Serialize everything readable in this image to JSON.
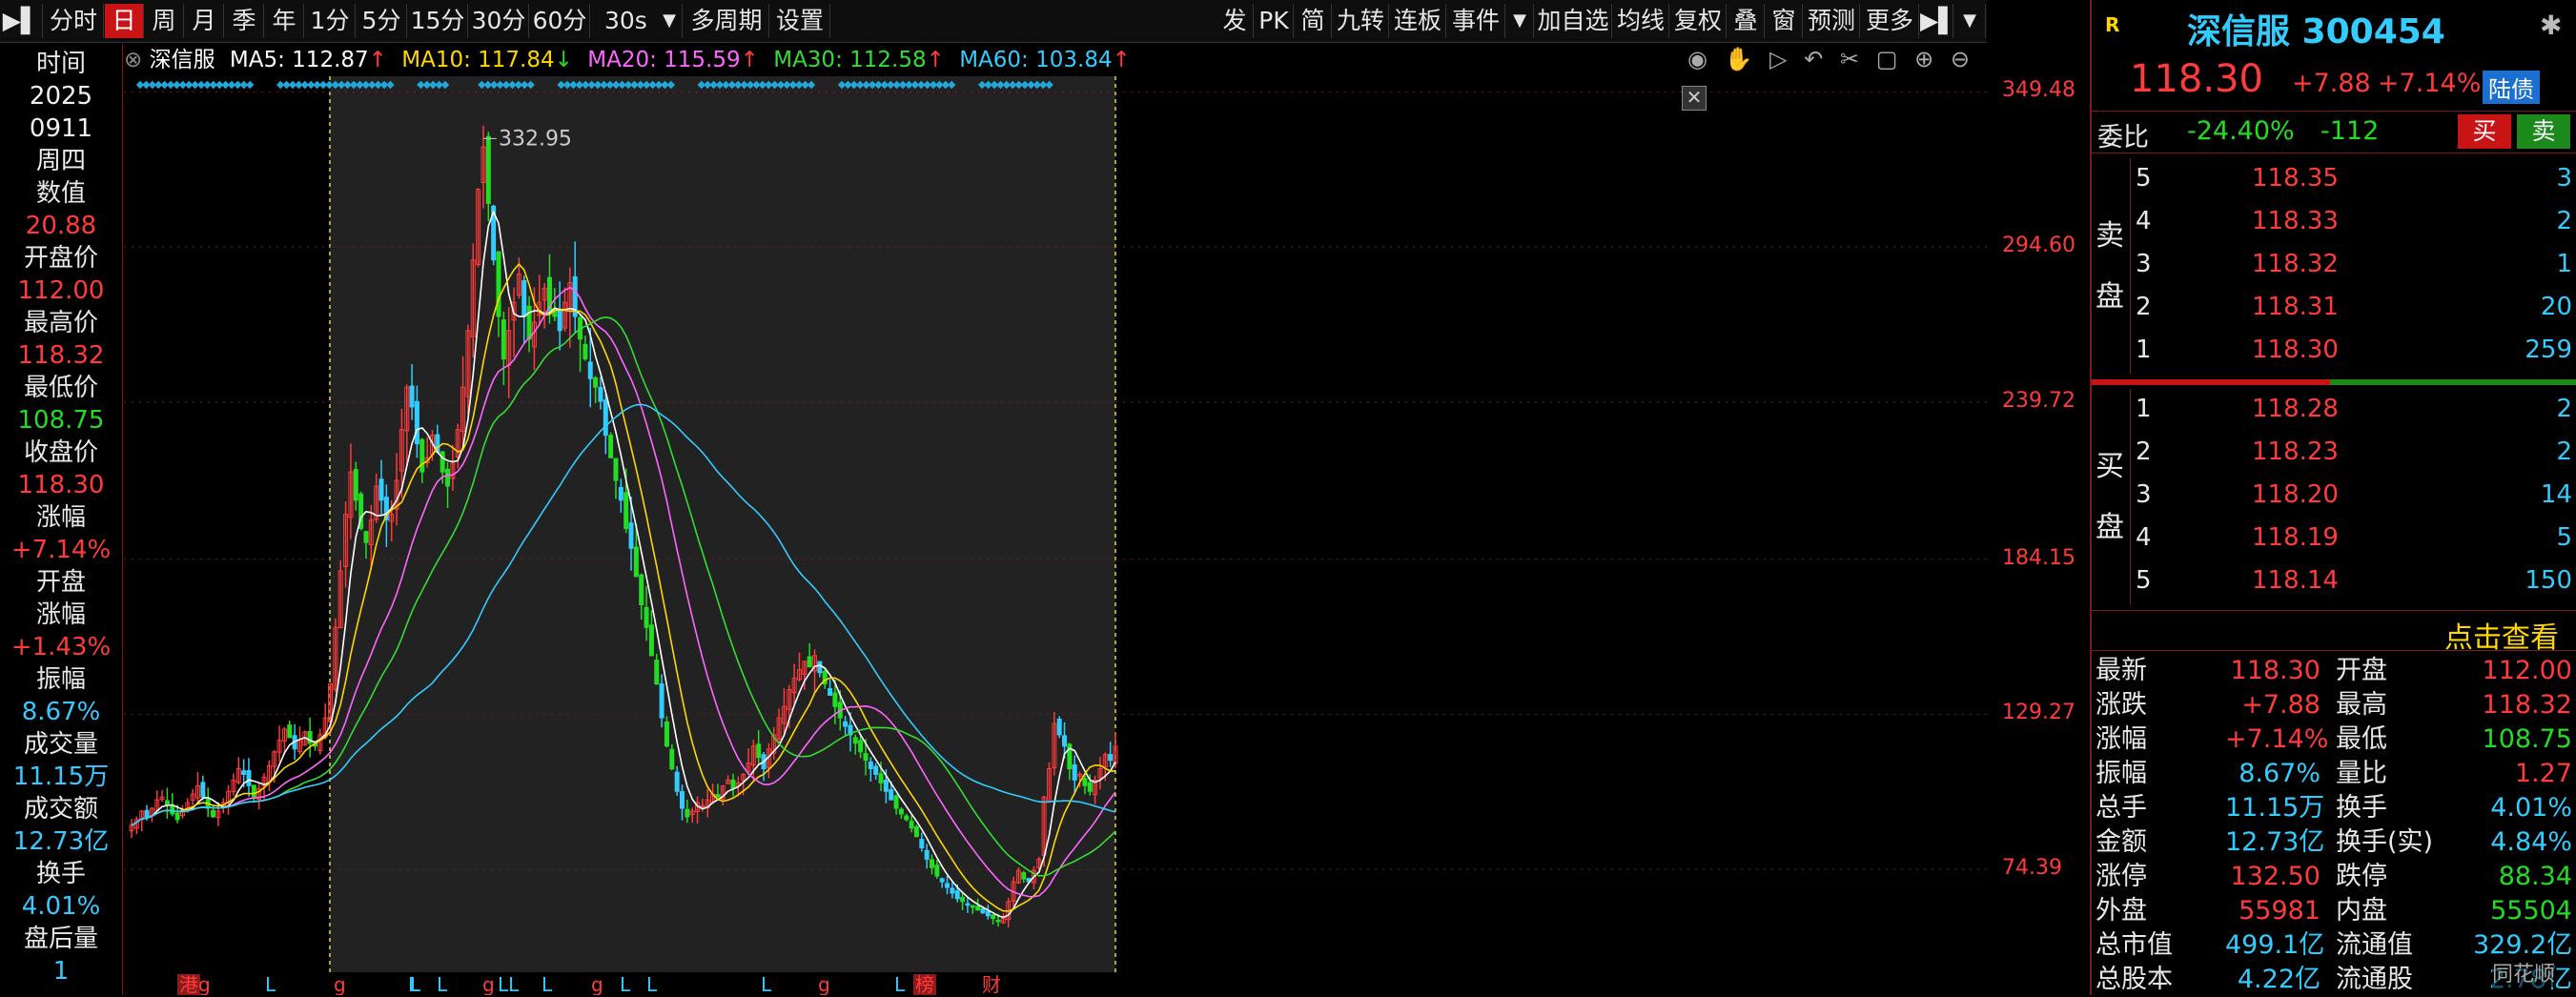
{
  "toolbar": {
    "left_icon": "pin-icon",
    "periods": [
      "分时",
      "日",
      "周",
      "月",
      "季",
      "年",
      "1分",
      "5分",
      "15分",
      "30分",
      "60分"
    ],
    "selected": "日",
    "dropdown_value": "30s",
    "multi_period": "多周期",
    "settings": "设置",
    "right_items": [
      "发",
      "PK",
      "简",
      "九转",
      "连板",
      "事件"
    ],
    "right_items2": [
      "加自选",
      "均线",
      "复权",
      "叠",
      "窗",
      "预测",
      "更多"
    ]
  },
  "left_info": [
    {
      "label": "时间",
      "value": "2025",
      "value2": "0911",
      "value3": "周四"
    },
    {
      "label": "数值",
      "value": "20.88"
    },
    {
      "label": "开盘价",
      "value": "112.00"
    },
    {
      "label": "最高价",
      "value": "118.32"
    },
    {
      "label": "最低价",
      "value": "108.75"
    },
    {
      "label": "收盘价",
      "value": "118.30"
    },
    {
      "label": "涨幅",
      "value": "+7.14%"
    },
    {
      "label": "开盘",
      "label2": "涨幅",
      "value": "+1.43%"
    },
    {
      "label": "振幅",
      "value": "8.67%"
    },
    {
      "label": "成交量",
      "value": "11.15万"
    },
    {
      "label": "成交额",
      "value": "12.73亿"
    },
    {
      "label": "换手",
      "value": "4.01%"
    },
    {
      "label": "盘后量",
      "value": "1"
    }
  ],
  "legend": {
    "stock": "深信服",
    "ma5": "MA5: 112.87",
    "ma10": "MA10: 117.84",
    "ma20": "MA20: 115.59",
    "ma30": "MA30: 112.58",
    "ma60": "MA60: 103.84",
    "ma5_arrow": "↑",
    "ma10_arrow": "↓",
    "ma20_arrow": "↑",
    "ma30_arrow": "↑",
    "ma60_arrow": "↑"
  },
  "colors": {
    "up": "#ff3b3b",
    "down": "#22dd22",
    "ma5": "#ffffff",
    "ma10": "#ffd700",
    "ma20": "#ff66ff",
    "ma30": "#33dd33",
    "ma60": "#33ccff",
    "accent": "#c81414"
  },
  "chart_data": {
    "type": "candlestick",
    "y_ticks": [
      "349.48",
      "294.60",
      "239.72",
      "184.15",
      "129.27",
      "74.39"
    ],
    "ylim": [
      38,
      355
    ],
    "peak_label": "332.95",
    "bottom_markers": [
      "港",
      "g",
      "L",
      "g",
      "L",
      "L",
      "L",
      "g",
      "LL",
      "L",
      "g",
      "L",
      "L",
      "L",
      "g",
      "L",
      "榜",
      "财"
    ],
    "close_series": [
      90,
      92,
      95,
      93,
      96,
      99,
      100,
      97,
      94,
      92,
      95,
      98,
      101,
      104,
      100,
      96,
      93,
      95,
      98,
      102,
      106,
      110,
      108,
      104,
      100,
      103,
      107,
      111,
      116,
      120,
      124,
      121,
      117,
      120,
      123,
      119,
      118,
      122,
      128,
      140,
      160,
      180,
      200,
      215,
      205,
      195,
      190,
      198,
      210,
      205,
      198,
      200,
      212,
      230,
      245,
      238,
      225,
      215,
      220,
      228,
      222,
      215,
      210,
      218,
      230,
      245,
      265,
      290,
      315,
      330,
      310,
      290,
      270,
      255,
      265,
      275,
      285,
      270,
      262,
      268,
      275,
      280,
      272,
      270,
      265,
      275,
      282,
      270,
      262,
      255,
      248,
      245,
      240,
      228,
      220,
      212,
      205,
      195,
      188,
      178,
      168,
      160,
      150,
      140,
      128,
      118,
      110,
      102,
      96,
      93,
      95,
      98,
      97,
      99,
      101,
      100,
      104,
      106,
      103,
      105,
      108,
      112,
      118,
      114,
      110,
      117,
      122,
      128,
      132,
      138,
      142,
      145,
      148,
      146,
      150,
      144,
      140,
      136,
      132,
      128,
      125,
      122,
      119,
      116,
      113,
      110,
      108,
      105,
      102,
      99,
      96,
      94,
      92,
      89,
      86,
      82,
      78,
      75,
      72,
      70,
      68,
      66,
      64,
      63,
      62,
      61,
      60,
      59,
      58,
      57,
      56,
      57,
      63,
      70,
      74,
      71,
      70,
      74,
      78,
      100,
      110,
      126,
      122,
      118,
      110,
      106,
      108,
      104,
      102,
      106,
      110,
      115,
      113,
      118
    ]
  },
  "right_panel": {
    "logo": "R",
    "name": "深信服",
    "code": "300454",
    "price": "118.30",
    "change": "+7.88",
    "change_pct": "+7.14%",
    "tag": "陆债",
    "webi_label": "委比",
    "webi_value": "-24.40%",
    "webi_diff": "-112",
    "buy_btn": "买",
    "sell_btn": "卖",
    "sell_label": [
      "卖",
      "盘"
    ],
    "buy_label": [
      "买",
      "盘"
    ],
    "asks": [
      {
        "level": "5",
        "price": "118.35",
        "vol": "3"
      },
      {
        "level": "4",
        "price": "118.33",
        "vol": "2"
      },
      {
        "level": "3",
        "price": "118.32",
        "vol": "1"
      },
      {
        "level": "2",
        "price": "118.31",
        "vol": "20"
      },
      {
        "level": "1",
        "price": "118.30",
        "vol": "259"
      }
    ],
    "bids": [
      {
        "level": "1",
        "price": "118.28",
        "vol": "2"
      },
      {
        "level": "2",
        "price": "118.23",
        "vol": "2"
      },
      {
        "level": "3",
        "price": "118.20",
        "vol": "14"
      },
      {
        "level": "4",
        "price": "118.19",
        "vol": "5"
      },
      {
        "level": "5",
        "price": "118.14",
        "vol": "150"
      }
    ],
    "click_view": "点击查看",
    "quotes": [
      {
        "l": "最新",
        "v": "118.30",
        "vc": "red",
        "l2": "开盘",
        "v2": "112.00",
        "v2c": "red"
      },
      {
        "l": "涨跌",
        "v": "+7.88",
        "vc": "red",
        "l2": "最高",
        "v2": "118.32",
        "v2c": "red"
      },
      {
        "l": "涨幅",
        "v": "+7.14%",
        "vc": "red",
        "l2": "最低",
        "v2": "108.75",
        "v2c": "green"
      },
      {
        "l": "振幅",
        "v": "8.67%",
        "vc": "cyan",
        "l2": "量比",
        "v2": "1.27",
        "v2c": "red"
      },
      {
        "l": "总手",
        "v": "11.15万",
        "vc": "cyan",
        "l2": "换手",
        "v2": "4.01%",
        "v2c": "cyan"
      },
      {
        "l": "金额",
        "v": "12.73亿",
        "vc": "cyan",
        "l2": "换手(实)",
        "v2": "4.84%",
        "v2c": "cyan"
      },
      {
        "l": "涨停",
        "v": "132.50",
        "vc": "red",
        "l2": "跌停",
        "v2": "88.34",
        "v2c": "green"
      },
      {
        "l": "外盘",
        "v": "55981",
        "vc": "red",
        "l2": "内盘",
        "v2": "55504",
        "v2c": "green"
      },
      {
        "l": "总市值",
        "v": "499.1亿",
        "vc": "cyan",
        "l2": "流通值",
        "v2": "329.2亿",
        "v2c": "cyan"
      },
      {
        "l": "总股本",
        "v": "4.22亿",
        "vc": "cyan",
        "l2": "流通股",
        "v2": "2.78亿",
        "v2c": "cyan"
      }
    ],
    "watermark": "同花顺"
  }
}
